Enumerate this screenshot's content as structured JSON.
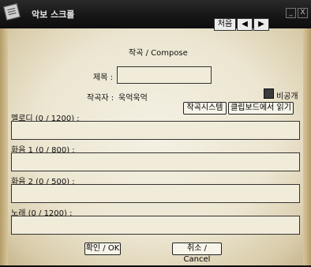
{
  "window": {
    "title": "악보 스크롤",
    "minimize_glyph": "_",
    "close_glyph": "X"
  },
  "nav": {
    "first_label": "처음",
    "prev_glyph": "◀",
    "next_glyph": "▶"
  },
  "form": {
    "heading": "작곡 / Compose",
    "title_label": "제목 :",
    "title_value": "",
    "composer_label": "작곡자 :",
    "composer_value": "욱억욱억",
    "private_label": "비공개",
    "composer_system_button": "작곡시스템",
    "clipboard_button": "클립보드에서 읽기",
    "melody_label": "멜로디 (0 / 1200) :",
    "chord1_label": "화음 1 (0 / 800) :",
    "chord2_label": "화음 2 (0 / 500) :",
    "song_label": "노래 (0 / 1200) :",
    "ok_button": "확인 / OK",
    "cancel_button": "취소 / Cancel"
  }
}
